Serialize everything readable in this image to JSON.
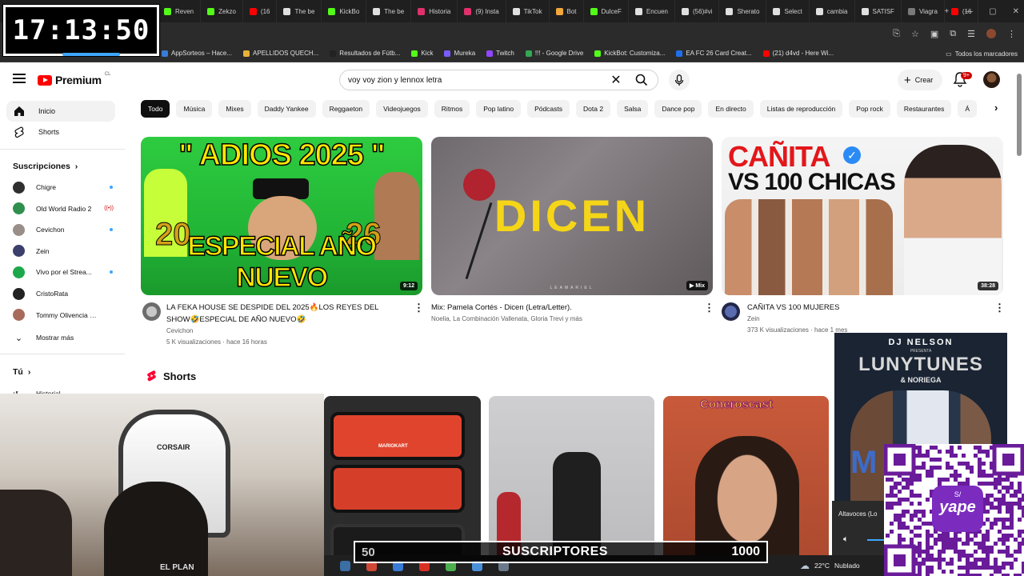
{
  "browser": {
    "tabs": [
      {
        "label": "Reven"
      },
      {
        "label": "Zekzo"
      },
      {
        "label": "(16"
      },
      {
        "label": "The be"
      },
      {
        "label": "KickBo"
      },
      {
        "label": "The be"
      },
      {
        "label": "Historia"
      },
      {
        "label": "(9) Insta"
      },
      {
        "label": "TikTok"
      },
      {
        "label": "Bot"
      },
      {
        "label": "DulceF"
      },
      {
        "label": "Encuen"
      },
      {
        "label": "(56)#vi"
      },
      {
        "label": "Sherato"
      },
      {
        "label": "Select"
      },
      {
        "label": "cambia"
      },
      {
        "label": "SATISF"
      },
      {
        "label": "Viagra"
      },
      {
        "label": "(16"
      }
    ],
    "bookmarks": [
      {
        "label": "AppSorteos – Hace..."
      },
      {
        "label": "APELLIDOS QUECH..."
      },
      {
        "label": "Resultados de Fútb..."
      },
      {
        "label": "Kick"
      },
      {
        "label": "Mureka"
      },
      {
        "label": "Twitch"
      },
      {
        "label": "!!! - Google Drive"
      },
      {
        "label": "KickBot: Customiza..."
      },
      {
        "label": "EA FC 26 Card Creat..."
      },
      {
        "label": "(21) d4vd - Here Wi..."
      }
    ],
    "all_bookmarks": "Todos los marcadores"
  },
  "clock": "17:13:50",
  "youtube": {
    "logo_text": "Premium",
    "region": "CL",
    "search_query": "voy voy zion y lennox letra",
    "create_label": "Crear",
    "notifications_badge": "9+",
    "sidebar": {
      "home": "Inicio",
      "shorts": "Shorts",
      "subscriptions_title": "Suscripciones",
      "subscriptions": [
        {
          "name": "Chigre",
          "indicator": "dot",
          "color": "#2f2f2f"
        },
        {
          "name": "Old World Radio 2",
          "indicator": "live",
          "color": "#2f8f4e"
        },
        {
          "name": "Cevichon",
          "indicator": "dot",
          "color": "#9a8f88"
        },
        {
          "name": "Zein",
          "indicator": "none",
          "color": "#3b3f6b"
        },
        {
          "name": "Vivo por el Strea...",
          "indicator": "dot",
          "color": "#1ca84a"
        },
        {
          "name": "CristoRata",
          "indicator": "none",
          "color": "#222222"
        },
        {
          "name": "Tommy Olivencia - ...",
          "indicator": "none",
          "color": "#a86b5b"
        }
      ],
      "show_more": "Mostrar más",
      "you_title": "Tú",
      "history": "Historial"
    },
    "chips": [
      "Todo",
      "Música",
      "Mixes",
      "Daddy Yankee",
      "Reggaeton",
      "Videojuegos",
      "Ritmos",
      "Pop latino",
      "Pódcasts",
      "Dota 2",
      "Salsa",
      "Dance pop",
      "En directo",
      "Listas de reproducción",
      "Pop rock",
      "Restaurantes",
      "Á"
    ],
    "videos": [
      {
        "thumb_top": "\" ADIOS 2025 \"",
        "thumb_bottom": "ESPECIAL AÑO NUEVO",
        "thumb_numbers": [
          "20",
          "26"
        ],
        "duration": "9:12",
        "title_line1": "LA FEKA HOUSE SE DESPIDE DEL 2025🔥LOS REYES DEL",
        "title_line2": "SHOW🤣ESPECIAL DE AÑO NUEVO🤣",
        "channel": "Cevichon",
        "meta": "5 K visualizaciones · hace 16 horas"
      },
      {
        "thumb_text": "DICEN",
        "thumb_small": "LEAMARIEL",
        "badge": "Mix",
        "title": "Mix: Pamela Cortés - Dicen (Letra/Letter).",
        "channel": "Noelia, La Combinación Vallenata, Gloria Trevi y más"
      },
      {
        "thumb_line1": "CAÑITA",
        "thumb_line2": "VS 100 CHICAS",
        "duration": "38:28",
        "title": "CAÑITA VS 100 MUJERES",
        "channel": "Zein",
        "meta": "373 K visualizaciones · hace 1 mes"
      }
    ],
    "shorts_title": "Shorts",
    "short_thumb_text": "Coneroscast",
    "switch_text": "MARIOKART"
  },
  "overlays": {
    "webcam_text": "CORSAIR",
    "shirt_text": "EL PLAN",
    "video_overlay": {
      "artist": "DJ NELSON",
      "presents": "PRESENTA",
      "title": "LUNYTUNES",
      "subtitle": "& NORIEGA",
      "letter": "M"
    },
    "volume_label": "Altavoces (Lo",
    "subs": {
      "current": "50",
      "label": "SUSCRIPTORES",
      "goal": "1000"
    },
    "weather": {
      "temp": "22°C",
      "condition": "Nublado"
    },
    "qr_brand": "yape",
    "qr_currency": "S/"
  },
  "colors": {
    "yt_red": "#ff0000",
    "chip_active": "#0f0f0f",
    "qr_purple": "#6a1b9a",
    "accent_blue": "#3ea6ff"
  }
}
